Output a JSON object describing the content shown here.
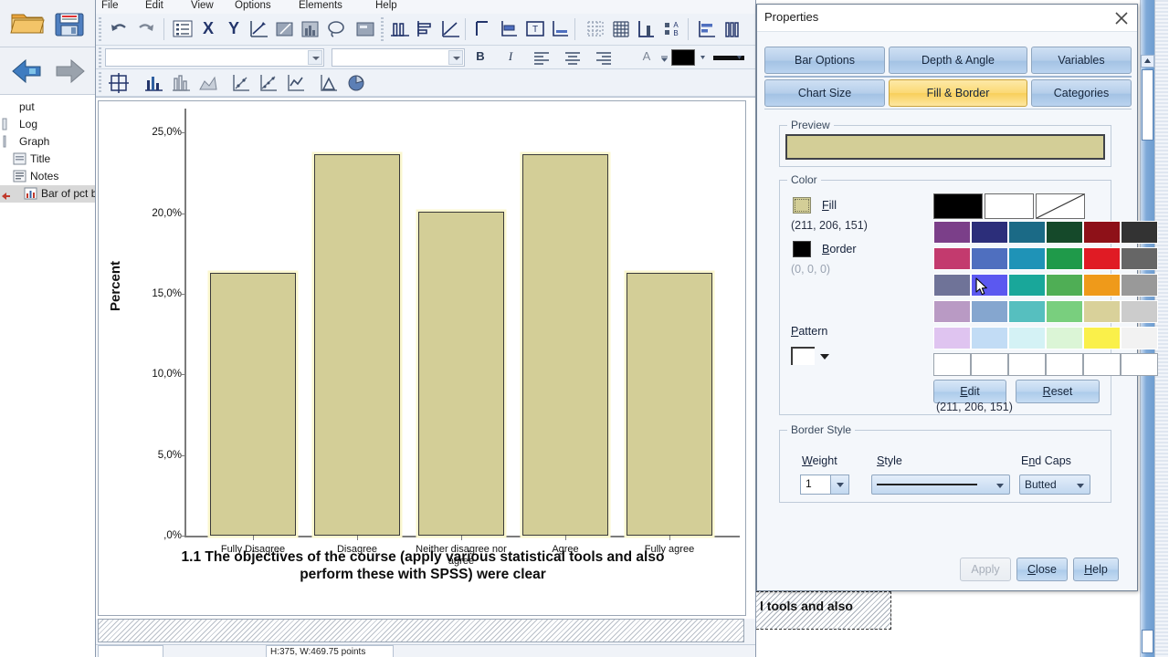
{
  "app": {
    "menu": [
      "File",
      "Edit",
      "View",
      "Options",
      "Elements",
      "Help"
    ]
  },
  "left_toolbar": {
    "open_icon": "open-folder-icon",
    "save_icon": "save-icon",
    "back_icon": "back-arrow-icon",
    "forward_icon": "forward-arrow-icon"
  },
  "outline": {
    "items": [
      {
        "label": "put",
        "icon": "output-icon",
        "indent": 1,
        "selected": false
      },
      {
        "label": "Log",
        "icon": "log-icon",
        "indent": 1,
        "selected": false
      },
      {
        "label": "Graph",
        "icon": "graph-icon",
        "indent": 1,
        "selected": false
      },
      {
        "label": "Title",
        "icon": "title-icon",
        "indent": 2,
        "selected": false
      },
      {
        "label": "Notes",
        "icon": "notes-icon",
        "indent": 2,
        "selected": false
      },
      {
        "label": "Bar of pct b",
        "icon": "bar-chart-icon",
        "indent": 2,
        "selected": true
      }
    ]
  },
  "format_toolbar": {
    "font_family_value": "",
    "font_size_value": "",
    "bold_label": "B",
    "italic_label": "I",
    "text_color_label": "A",
    "align_left": "align-left-icon",
    "align_center": "align-center-icon",
    "align_right": "align-right-icon"
  },
  "status": {
    "dimensions": "H:375, W:469.75 points"
  },
  "chart_data": {
    "type": "bar",
    "title": "1.1 The objectives of the course (apply various statistical tools and also perform these with SPSS) were clear",
    "title_line1": "1.1 The objectives of the course (apply various statistical tools and also",
    "title_line2": "perform these with SPSS) were clear",
    "xlabel": "",
    "ylabel": "Percent",
    "categories": [
      "Fully Disagree",
      "Disagree",
      "Neither disagree nor agree",
      "Agree",
      "Fully agree"
    ],
    "values": [
      16.3,
      23.7,
      20.1,
      23.7,
      16.3
    ],
    "ylim": [
      0,
      26.5
    ],
    "ytick_values": [
      0,
      5,
      10,
      15,
      20,
      25
    ],
    "ytick_labels": [
      ",0%",
      "5,0%",
      "10,0%",
      "15,0%",
      "20,0%",
      "25,0%"
    ],
    "grid": false,
    "legend": "none",
    "bar_fill": "#d3ce97",
    "bar_border": "#3a3a3a",
    "selection_highlight": "#fbf7cf"
  },
  "output_pane": {
    "fragment_text": "l tools and also"
  },
  "dialog": {
    "title": "Properties",
    "close_icon": "close-icon",
    "tabs_row1": [
      "Bar Options",
      "Depth & Angle",
      "Variables"
    ],
    "tabs_row2": [
      "Chart Size",
      "Fill & Border",
      "Categories"
    ],
    "active_tab": "Fill & Border",
    "preview": {
      "label": "Preview",
      "fill_color": "#d3ce97",
      "border_color": "#3f4248"
    },
    "color_group": {
      "label": "Color",
      "fill_label": "Fill",
      "fill_rgb": "(211, 206, 151)",
      "fill_color": "#d3ce97",
      "border_label": "Border",
      "border_rgb": "(0, 0, 0)",
      "border_color": "#000000",
      "pattern_label": "Pattern",
      "selected_rgb": "(211, 206, 151)",
      "edit_button": "Edit",
      "reset_button": "Reset",
      "palette_rows": [
        [
          "#000000",
          "#ffffff",
          "__NONE__"
        ],
        [
          "#7b3f89",
          "#2c2e7a",
          "#1b6a86",
          "#15492a",
          "#8e1118",
          "#333333"
        ],
        [
          "#c33a6e",
          "#4f6fbf",
          "#1f93b7",
          "#1f9a4a",
          "#e01b24",
          "#666666"
        ],
        [
          "#6f7398",
          "#5b58f0",
          "#19a79a",
          "#4fae55",
          "#ef9a1a",
          "#999999"
        ],
        [
          "#b99ac4",
          "#85a6cf",
          "#56bfbf",
          "#79cf7e",
          "#d9d19a",
          "#cccccc"
        ],
        [
          "#dfc4f0",
          "#c2dcf5",
          "#d4f2f5",
          "#dbf5d6",
          "#faf04a",
          "#f2f2f2"
        ],
        [
          "#ffffff",
          "#ffffff",
          "#ffffff",
          "#ffffff",
          "#ffffff",
          "#ffffff"
        ]
      ]
    },
    "border_style": {
      "label": "Border Style",
      "weight_label": "Weight",
      "weight_value": "1",
      "style_label": "Style",
      "style_value": "",
      "endcaps_label": "End Caps",
      "endcaps_value": "Butted"
    },
    "buttons": {
      "apply": "Apply",
      "apply_enabled": false,
      "close": "Close",
      "help": "Help"
    }
  }
}
